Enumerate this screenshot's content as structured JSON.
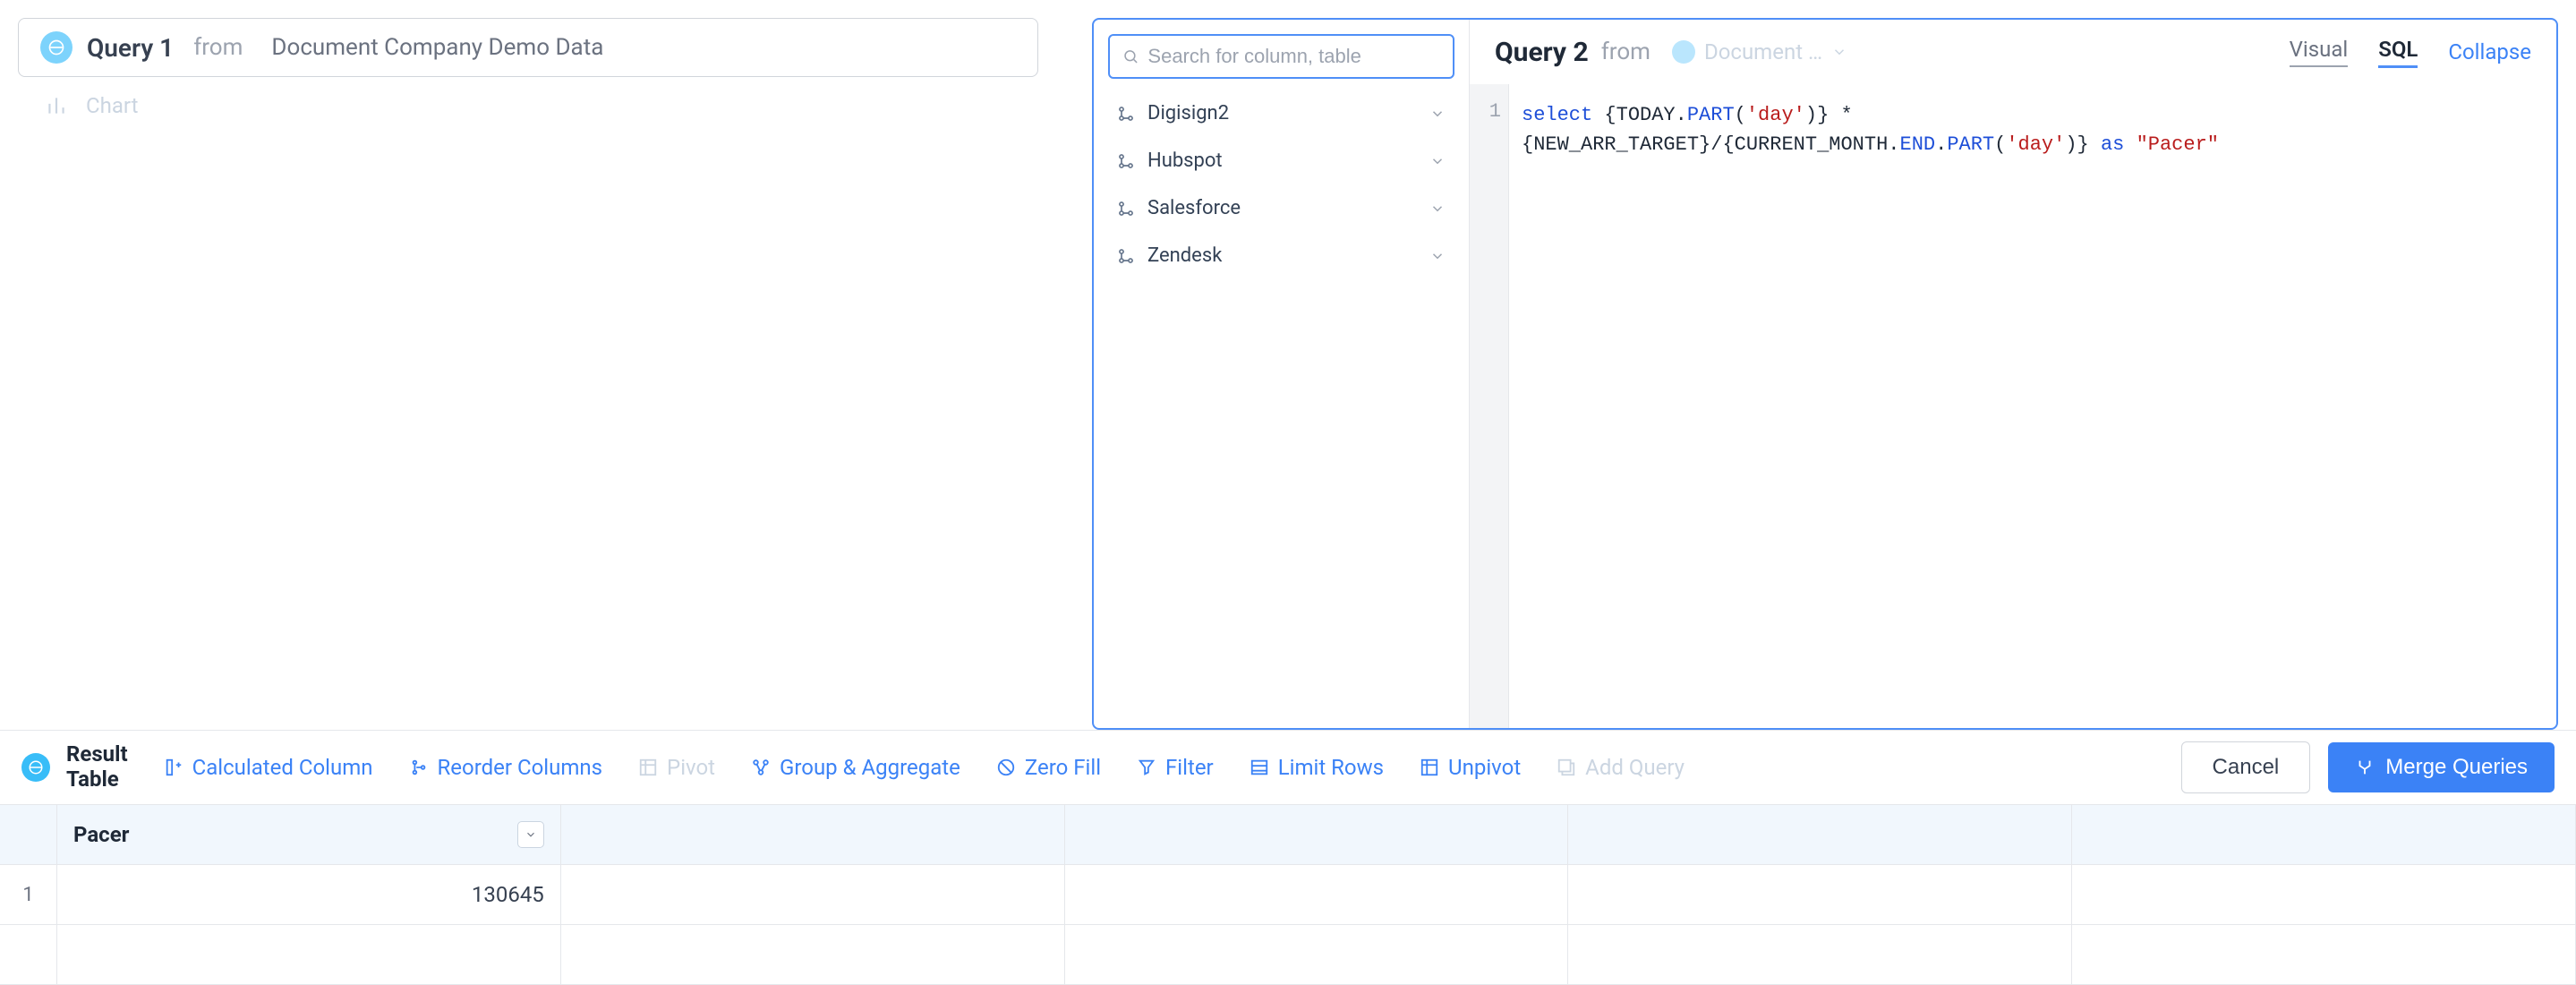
{
  "query1": {
    "title": "Query 1",
    "from_label": "from",
    "source": "Document Company Demo Data",
    "chart_label": "Chart"
  },
  "query2": {
    "title": "Query 2",
    "from_label": "from",
    "source_truncated": "Document …",
    "tabs": {
      "visual": "Visual",
      "sql": "SQL"
    },
    "collapse": "Collapse",
    "search_placeholder": "Search for column, table",
    "tree": [
      {
        "label": "Digisign2"
      },
      {
        "label": "Hubspot"
      },
      {
        "label": "Salesforce"
      },
      {
        "label": "Zendesk"
      }
    ],
    "line_number": "1",
    "sql_tokens": {
      "select": "select",
      "today": "TODAY",
      "part1": "PART",
      "day1": "'day'",
      "new_arr": "NEW_ARR_TARGET",
      "current_month": "CURRENT_MONTH",
      "end": "END",
      "part2": "PART",
      "day2": "'day'",
      "as": "as",
      "pacer": "\"Pacer\""
    }
  },
  "result": {
    "title_line1": "Result",
    "title_line2": "Table",
    "toolbar": {
      "calc_column": "Calculated Column",
      "reorder": "Reorder Columns",
      "pivot": "Pivot",
      "group": "Group & Aggregate",
      "zero_fill": "Zero Fill",
      "filter": "Filter",
      "limit": "Limit Rows",
      "unpivot": "Unpivot",
      "add_query": "Add Query"
    },
    "cancel": "Cancel",
    "merge": "Merge Queries",
    "columns": [
      "Pacer",
      "",
      "",
      "",
      ""
    ],
    "rows": [
      {
        "num": "1",
        "cells": [
          "130645",
          "",
          "",
          "",
          ""
        ]
      }
    ]
  }
}
